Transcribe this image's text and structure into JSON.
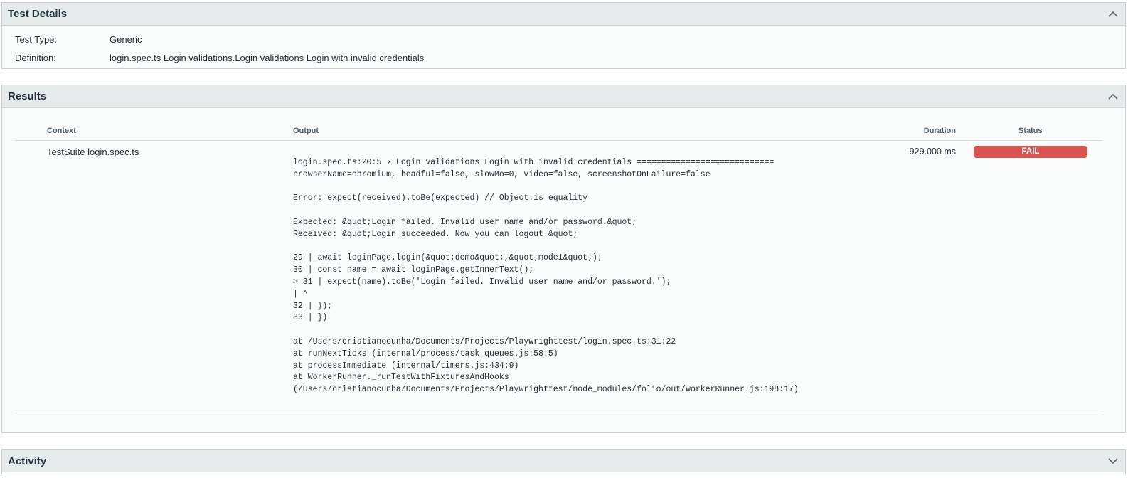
{
  "test_details": {
    "title": "Test Details",
    "fields": [
      {
        "label": "Test Type:",
        "value": "Generic"
      },
      {
        "label": "Definition:",
        "value": "login.spec.ts Login validations.Login validations Login with invalid credentials"
      }
    ]
  },
  "results": {
    "title": "Results",
    "columns": {
      "context": "Context",
      "output": "Output",
      "duration": "Duration",
      "status": "Status"
    },
    "rows": [
      {
        "context": "TestSuite login.spec.ts",
        "output": "login.spec.ts:20:5 › Login validations Login with invalid credentials ============================\nbrowserName=chromium, headful=false, slowMo=0, video=false, screenshotOnFailure=false\n\nError: expect(received).toBe(expected) // Object.is equality\n\nExpected: &quot;Login failed. Invalid user name and/or password.&quot;\nReceived: &quot;Login succeeded. Now you can logout.&quot;\n\n29 | await loginPage.login(&quot;demo&quot;,&quot;mode1&quot;);\n30 | const name = await loginPage.getInnerText();\n> 31 | expect(name).toBe('Login failed. Invalid user name and/or password.');\n| ^\n32 | });\n33 | })\n\nat /Users/cristianocunha/Documents/Projects/Playwrighttest/login.spec.ts:31:22\nat runNextTicks (internal/process/task_queues.js:58:5)\nat processImmediate (internal/timers.js:434:9)\nat WorkerRunner._runTestWithFixturesAndHooks\n(/Users/cristianocunha/Documents/Projects/Playwrighttest/node_modules/folio/out/workerRunner.js:198:17)",
        "duration": "929.000 ms",
        "status": "FAIL"
      }
    ]
  },
  "activity": {
    "title": "Activity"
  },
  "colors": {
    "header_bg": "#e6eaeb",
    "fail": "#d9534f"
  },
  "icons": {
    "details_toggle": "chevron-up-icon",
    "results_toggle": "chevron-up-icon",
    "activity_toggle": "chevron-down-icon"
  }
}
